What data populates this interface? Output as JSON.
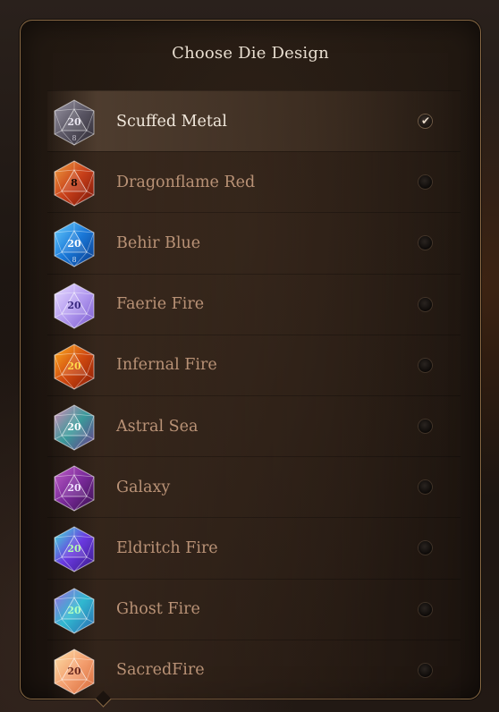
{
  "dialog": {
    "title": "Choose Die Design"
  },
  "dice": [
    {
      "name": "Scuffed Metal",
      "selected": true,
      "face": "20",
      "sub": "8",
      "colors": [
        "#2e2a33",
        "#5a5664",
        "#9a96a4"
      ],
      "ink": "#e8e4ef",
      "icon": "d20-scuffed-metal-icon"
    },
    {
      "name": "Dragonflame Red",
      "selected": false,
      "face": "8",
      "sub": "",
      "colors": [
        "#7a1508",
        "#c8401a",
        "#f0a040"
      ],
      "ink": "#1a0a05",
      "icon": "d20-dragonflame-red-icon"
    },
    {
      "name": "Behir Blue",
      "selected": false,
      "face": "20",
      "sub": "8",
      "colors": [
        "#0a3a8a",
        "#1a78d8",
        "#6ad0ff"
      ],
      "ink": "#ffffff",
      "icon": "d20-behir-blue-icon"
    },
    {
      "name": "Faerie Fire",
      "selected": false,
      "face": "20",
      "sub": "",
      "colors": [
        "#7a5ad0",
        "#b49cf0",
        "#e8dcff"
      ],
      "ink": "#3a2a80",
      "icon": "d20-faerie-fire-icon"
    },
    {
      "name": "Infernal Fire",
      "selected": false,
      "face": "20",
      "sub": "",
      "colors": [
        "#8a1a06",
        "#d04a10",
        "#ffb020"
      ],
      "ink": "#ffd84a",
      "icon": "d20-infernal-fire-icon"
    },
    {
      "name": "Astral Sea",
      "selected": false,
      "face": "20",
      "sub": "",
      "colors": [
        "#6a3a8a",
        "#3a9a9a",
        "#d88ab8"
      ],
      "ink": "#ffffff",
      "icon": "d20-astral-sea-icon"
    },
    {
      "name": "Galaxy",
      "selected": false,
      "face": "20",
      "sub": "",
      "colors": [
        "#3a1050",
        "#7a2a9a",
        "#c060c8"
      ],
      "ink": "#f0e0ff",
      "icon": "d20-galaxy-icon"
    },
    {
      "name": "Eldritch Fire",
      "selected": false,
      "face": "20",
      "sub": "",
      "colors": [
        "#3a1a8a",
        "#6a3ae0",
        "#40e8d8"
      ],
      "ink": "#b0ffb0",
      "icon": "d20-eldritch-fire-icon"
    },
    {
      "name": "Ghost Fire",
      "selected": false,
      "face": "20",
      "sub": "",
      "colors": [
        "#2a6ab0",
        "#30b8d0",
        "#a06ae0"
      ],
      "ink": "#b0ffc0",
      "icon": "d20-ghost-fire-icon"
    },
    {
      "name": "SacredFire",
      "selected": false,
      "face": "20",
      "sub": "",
      "colors": [
        "#d86a3a",
        "#f4a070",
        "#fbe0a8"
      ],
      "ink": "#6a2a20",
      "icon": "d20-sacred-fire-icon"
    }
  ]
}
